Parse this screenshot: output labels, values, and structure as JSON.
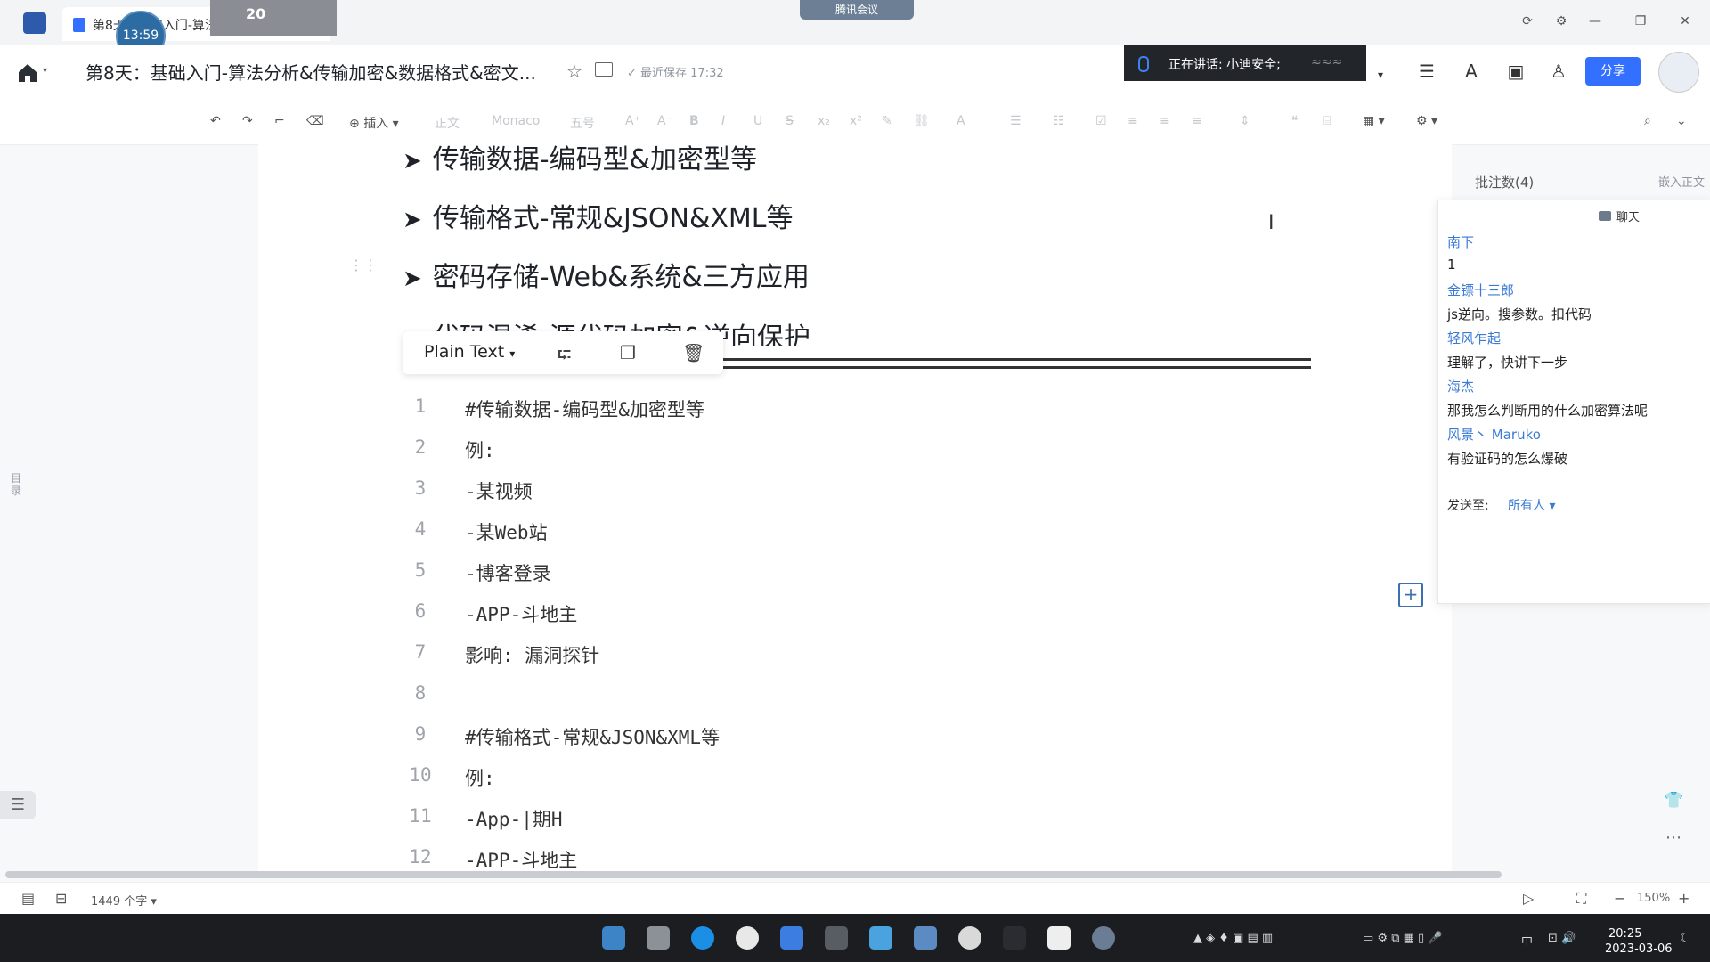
{
  "window": {
    "tab_title": "第8天：基础入门-算法分...",
    "timer": "13:59",
    "meeting_count": "20",
    "meeting_label": "腾讯会议"
  },
  "header": {
    "doc_title": "第8天：基础入门-算法分析&传输加密&数据格式&密文...",
    "save_status": "最近保存 17:32",
    "speaking_label": "正在讲话: 小迪安全;",
    "share_label": "分享"
  },
  "toolbar": {
    "insert_label": "插入",
    "style_label": "正文",
    "font_label": "Monaco",
    "size_label": "五号"
  },
  "outline_label": "目录",
  "document": {
    "headings": [
      "传输数据-编码型&加密型等",
      "传输格式-常规&JSON&XML等",
      "密码存储-Web&系统&三方应用",
      "代码混淆-源代码加密&逆向保护"
    ],
    "code_language": "Plain Text",
    "code_lines": [
      {
        "n": "1",
        "text": "#传输数据-编码型&加密型等"
      },
      {
        "n": "2",
        "text": "例:"
      },
      {
        "n": "3",
        "text": "-某视频"
      },
      {
        "n": "4",
        "text": "-某Web站"
      },
      {
        "n": "5",
        "text": "-博客登录"
      },
      {
        "n": "6",
        "text": "-APP-斗地主"
      },
      {
        "n": "7",
        "text": "影响: 漏洞探针"
      },
      {
        "n": "8",
        "text": ""
      },
      {
        "n": "9",
        "text": "#传输格式-常规&JSON&XML等"
      },
      {
        "n": "10",
        "text": "例:"
      },
      {
        "n": "11",
        "text": "-App-|期H"
      },
      {
        "n": "12",
        "text": "-APP-斗地主"
      }
    ]
  },
  "comments": {
    "header": "批注数(4)",
    "embed_label": "嵌入正文",
    "chat_title": "聊天",
    "messages": [
      {
        "name": "南下",
        "text": "1"
      },
      {
        "name": "金镖十三郎",
        "text": "js逆向。搜参数。扣代码"
      },
      {
        "name": "轻风乍起",
        "text": "理解了，快讲下一步"
      },
      {
        "name": "海杰",
        "text": "那我怎么判断用的什么加密算法呢"
      },
      {
        "name": "风景丶 Maruko",
        "text": "有验证码的怎么爆破"
      }
    ],
    "send_to_label": "发送至:",
    "send_target": "所有人"
  },
  "status": {
    "word_count": "1449 个字",
    "zoom": "150%"
  },
  "taskbar": {
    "time": "20:25",
    "date": "2023-03-06",
    "ime": "中"
  },
  "colors": {
    "accent": "#3370ff",
    "chat_name": "#3a7bd5",
    "taskbar": "#1c1d21"
  }
}
